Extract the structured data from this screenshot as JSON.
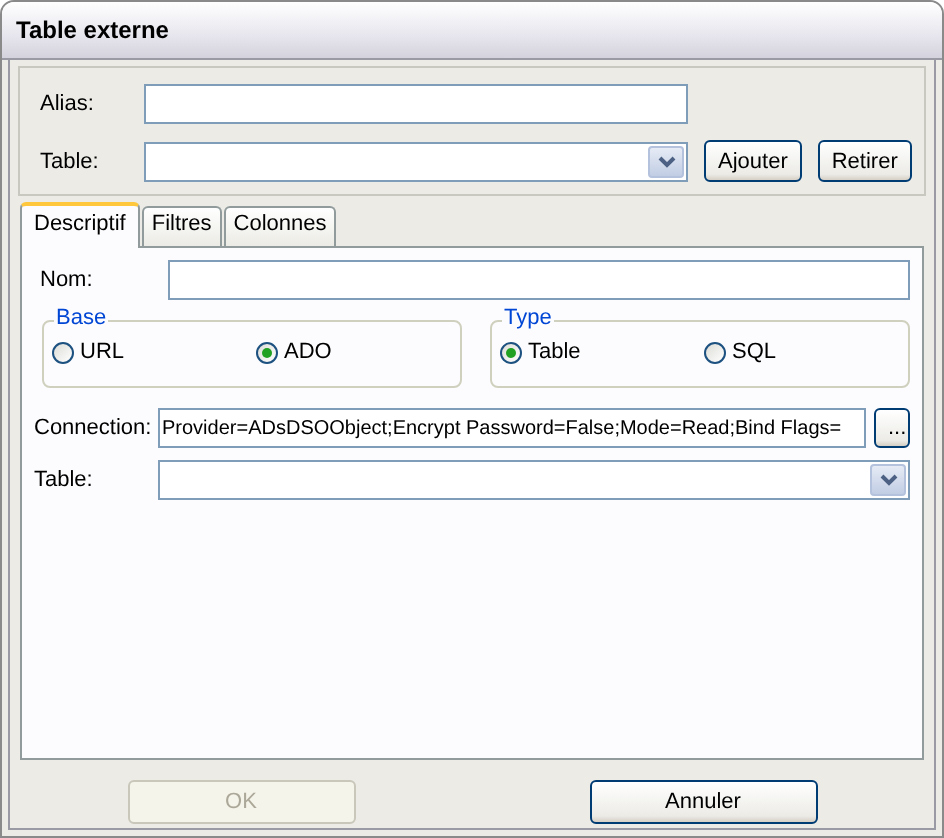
{
  "window": {
    "title": "Table externe"
  },
  "alias": {
    "label": "Alias:"
  },
  "table": {
    "label": "Table:"
  },
  "table_buttons": [
    {
      "label": "Ajouter",
      "disabled": false
    },
    {
      "label": "Retirer",
      "disabled": false
    }
  ],
  "tabs": [
    {
      "label": "Descriptif",
      "selected": true
    },
    {
      "label": "Filtres",
      "selected": false
    },
    {
      "label": "Colonnes",
      "selected": false
    }
  ],
  "nom": {
    "label": "Nom:"
  },
  "groups": [
    {
      "title": "Base",
      "options": [
        {
          "label": "URL",
          "selected": false
        },
        {
          "label": "ADO",
          "selected": true
        }
      ]
    },
    {
      "title": "Type",
      "options": [
        {
          "label": "Table",
          "selected": true
        },
        {
          "label": "SQL",
          "selected": false
        }
      ]
    }
  ],
  "connection": {
    "label": "Connection:",
    "value": "Provider=ADsDSOObject;Encrypt Password=False;Mode=Read;Bind Flags=",
    "button": "..."
  },
  "table2": {
    "label": "Table:"
  },
  "buttons": [
    {
      "label": "OK",
      "disabled": true
    },
    {
      "label": "Annuler",
      "disabled": false
    }
  ]
}
